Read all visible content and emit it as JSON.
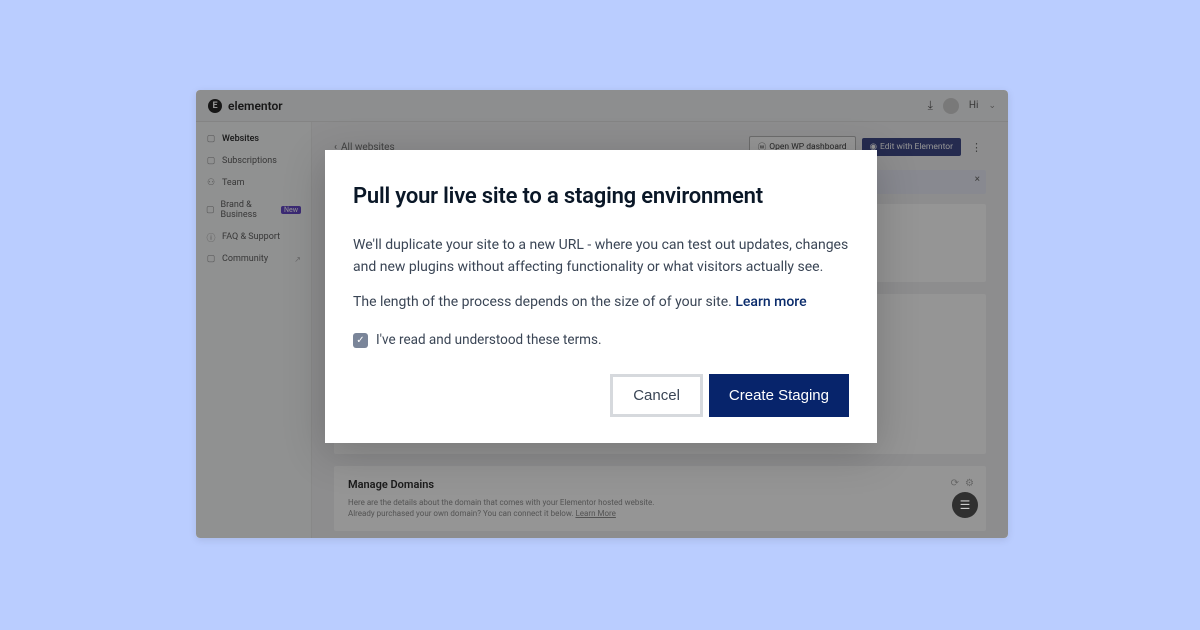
{
  "brand": "elementor",
  "topbar": {
    "greeting": "Hi"
  },
  "sidebar": {
    "items": [
      {
        "icon": "▢",
        "label": "Websites",
        "active": true
      },
      {
        "icon": "▢",
        "label": "Subscriptions"
      },
      {
        "icon": "▢",
        "label": "Team"
      },
      {
        "icon": "▢",
        "label": "Brand & Business",
        "badge": "New"
      },
      {
        "icon": "▢",
        "label": "FAQ & Support"
      },
      {
        "icon": "▢",
        "label": "Community",
        "ext": "↗"
      }
    ]
  },
  "main": {
    "back": "‹",
    "breadcrumb": "All websites",
    "open_wp": "Open WP dashboard",
    "edit_btn": "Edit with Elementor",
    "domains": {
      "title": "Manage Domains",
      "desc1": "Here are the details about the domain that comes with your Elementor hosted website.",
      "desc2": "Already purchased your own domain? You can connect it below.",
      "learn": "Learn More"
    }
  },
  "modal": {
    "title": "Pull your live site to a staging environment",
    "p1": "We'll duplicate your site to a new URL - where you can test out updates, changes and new plugins without affecting functionality or what visitors actually see.",
    "p2": "The length of the process depends on the size of of your site. ",
    "learn_more": "Learn more",
    "consent": "I've read and understood these terms.",
    "cancel": "Cancel",
    "create": "Create Staging"
  }
}
